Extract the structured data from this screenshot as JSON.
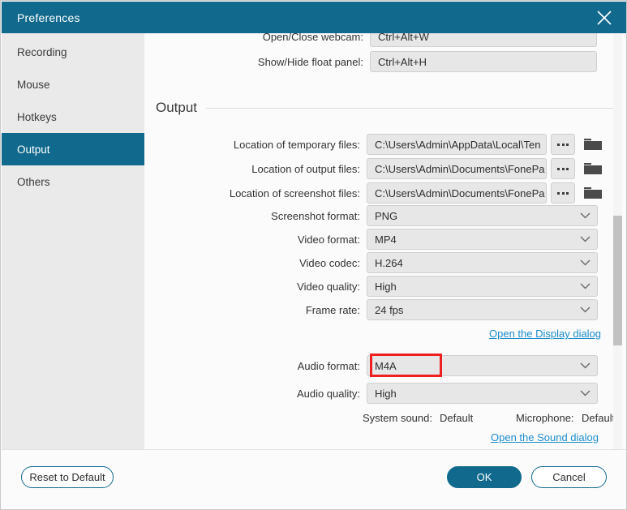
{
  "window": {
    "title": "Preferences",
    "close_icon": "close-icon",
    "accent_color": "#116A8D",
    "link_color": "#1c8ccc",
    "highlight_color": "#f02020"
  },
  "sidebar": {
    "items": [
      {
        "label": "Recording",
        "active": false
      },
      {
        "label": "Mouse",
        "active": false
      },
      {
        "label": "Hotkeys",
        "active": false
      },
      {
        "label": "Output",
        "active": true
      },
      {
        "label": "Others",
        "active": false
      }
    ]
  },
  "content": {
    "hotkey_rows": [
      {
        "label": "Open/Close webcam:",
        "value": "Ctrl+Alt+W"
      },
      {
        "label": "Show/Hide float panel:",
        "value": "Ctrl+Alt+H"
      }
    ],
    "section_title": "Output",
    "path_rows": [
      {
        "label": "Location of temporary files:",
        "value": "C:\\Users\\Admin\\AppData\\Local\\Ten",
        "browse_label": "browse-dots",
        "folder_label": "folder-icon"
      },
      {
        "label": "Location of output files:",
        "value": "C:\\Users\\Admin\\Documents\\FonePa",
        "browse_label": "browse-dots",
        "folder_label": "folder-icon"
      },
      {
        "label": "Location of screenshot files:",
        "value": "C:\\Users\\Admin\\Documents\\FonePa",
        "browse_label": "browse-dots",
        "folder_label": "folder-icon"
      }
    ],
    "select_rows": [
      {
        "label": "Screenshot format:",
        "value": "PNG"
      },
      {
        "label": "Video format:",
        "value": "MP4"
      },
      {
        "label": "Video codec:",
        "value": "H.264"
      },
      {
        "label": "Video quality:",
        "value": "High"
      },
      {
        "label": "Frame rate:",
        "value": "24 fps"
      }
    ],
    "display_dialog_link": "Open the Display dialog",
    "audio_rows": [
      {
        "label": "Audio format:",
        "value": "M4A",
        "highlighted": true
      },
      {
        "label": "Audio quality:",
        "value": "High",
        "highlighted": false
      }
    ],
    "system_sound_label": "System sound:",
    "system_sound_value": "Default",
    "microphone_label": "Microphone:",
    "microphone_value": "Default",
    "sound_dialog_link": "Open the Sound dialog"
  },
  "footer": {
    "reset_label": "Reset to Default",
    "ok_label": "OK",
    "cancel_label": "Cancel"
  }
}
